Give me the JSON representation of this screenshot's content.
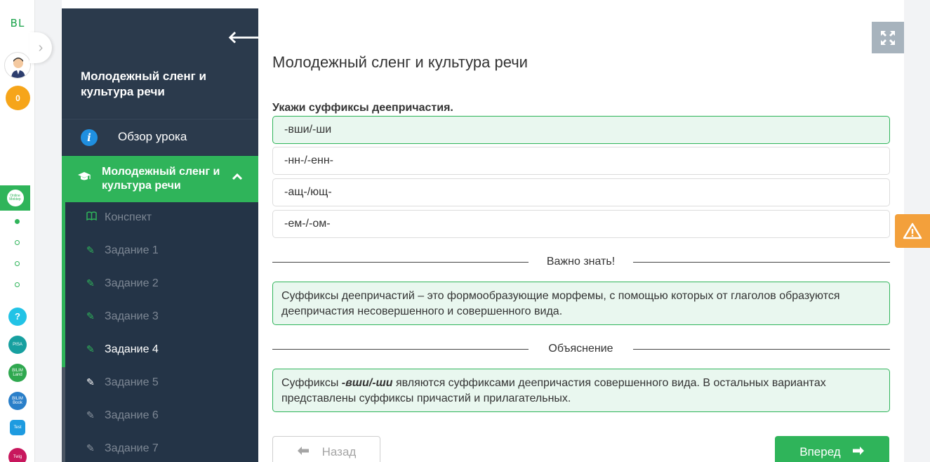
{
  "rail": {
    "logo": "BL",
    "coins": "0",
    "online_label": "Online Mektep",
    "apps": [
      {
        "icon": "help-icon",
        "label": "?",
        "color": "#22c3e6"
      },
      {
        "icon": "pisa-icon",
        "label": "PISA",
        "color": "#17a0a0"
      },
      {
        "icon": "bilimland-icon",
        "label": "BILIM Land",
        "color": "#2fa84f"
      },
      {
        "icon": "bilimbook-icon",
        "label": "BILIM Book",
        "color": "#2a7fc9"
      },
      {
        "icon": "test-icon",
        "label": "Test",
        "color": "#1e9be0"
      },
      {
        "icon": "twig-icon",
        "label": "Twig",
        "color": "#c8175d"
      }
    ]
  },
  "sidebar": {
    "title": "Молодежный сленг и культура речи",
    "overview_label": "Обзор урока",
    "section_label": "Молодежный сленг и культура речи",
    "items": [
      {
        "label": "Конспект",
        "icon": "book-icon"
      },
      {
        "label": "Задание 1",
        "icon": "edit-icon"
      },
      {
        "label": "Задание 2",
        "icon": "edit-icon"
      },
      {
        "label": "Задание 3",
        "icon": "edit-icon"
      },
      {
        "label": "Задание 4",
        "icon": "edit-icon",
        "active": true
      },
      {
        "label": "Задание 5",
        "icon": "edit-icon"
      },
      {
        "label": "Задание 6",
        "icon": "edit-icon"
      },
      {
        "label": "Задание 7",
        "icon": "edit-icon"
      }
    ]
  },
  "main": {
    "title": "Молодежный сленг и культура речи",
    "question": "Укажи суффиксы деепричастия.",
    "options": [
      {
        "text": "-вши/-ши",
        "correct": true
      },
      {
        "text": "-нн-/-енн-",
        "correct": false
      },
      {
        "text": "-ащ-/ющ-",
        "correct": false
      },
      {
        "text": "-ем-/-ом-",
        "correct": false
      }
    ],
    "important_heading": "Важно знать!",
    "important_text": "Суффиксы деепричастий – это формообразующие морфемы, с помощью которых от глаголов образуются деепричастия несовершенного и совершенного вида.",
    "explanation_heading": "Объяснение",
    "explanation_prefix": "Суффиксы ",
    "explanation_emph": "-вши/-ши",
    "explanation_suffix": " являются суффиксами деепричастия совершенного вида. В остальных вариантах представлены суффиксы причастий и прилагательных.",
    "back_label": "Назад",
    "next_label": "Вперед"
  },
  "colors": {
    "accent": "#2fb45a",
    "sidebar_bg": "#243447",
    "warning": "#f3a03b"
  }
}
